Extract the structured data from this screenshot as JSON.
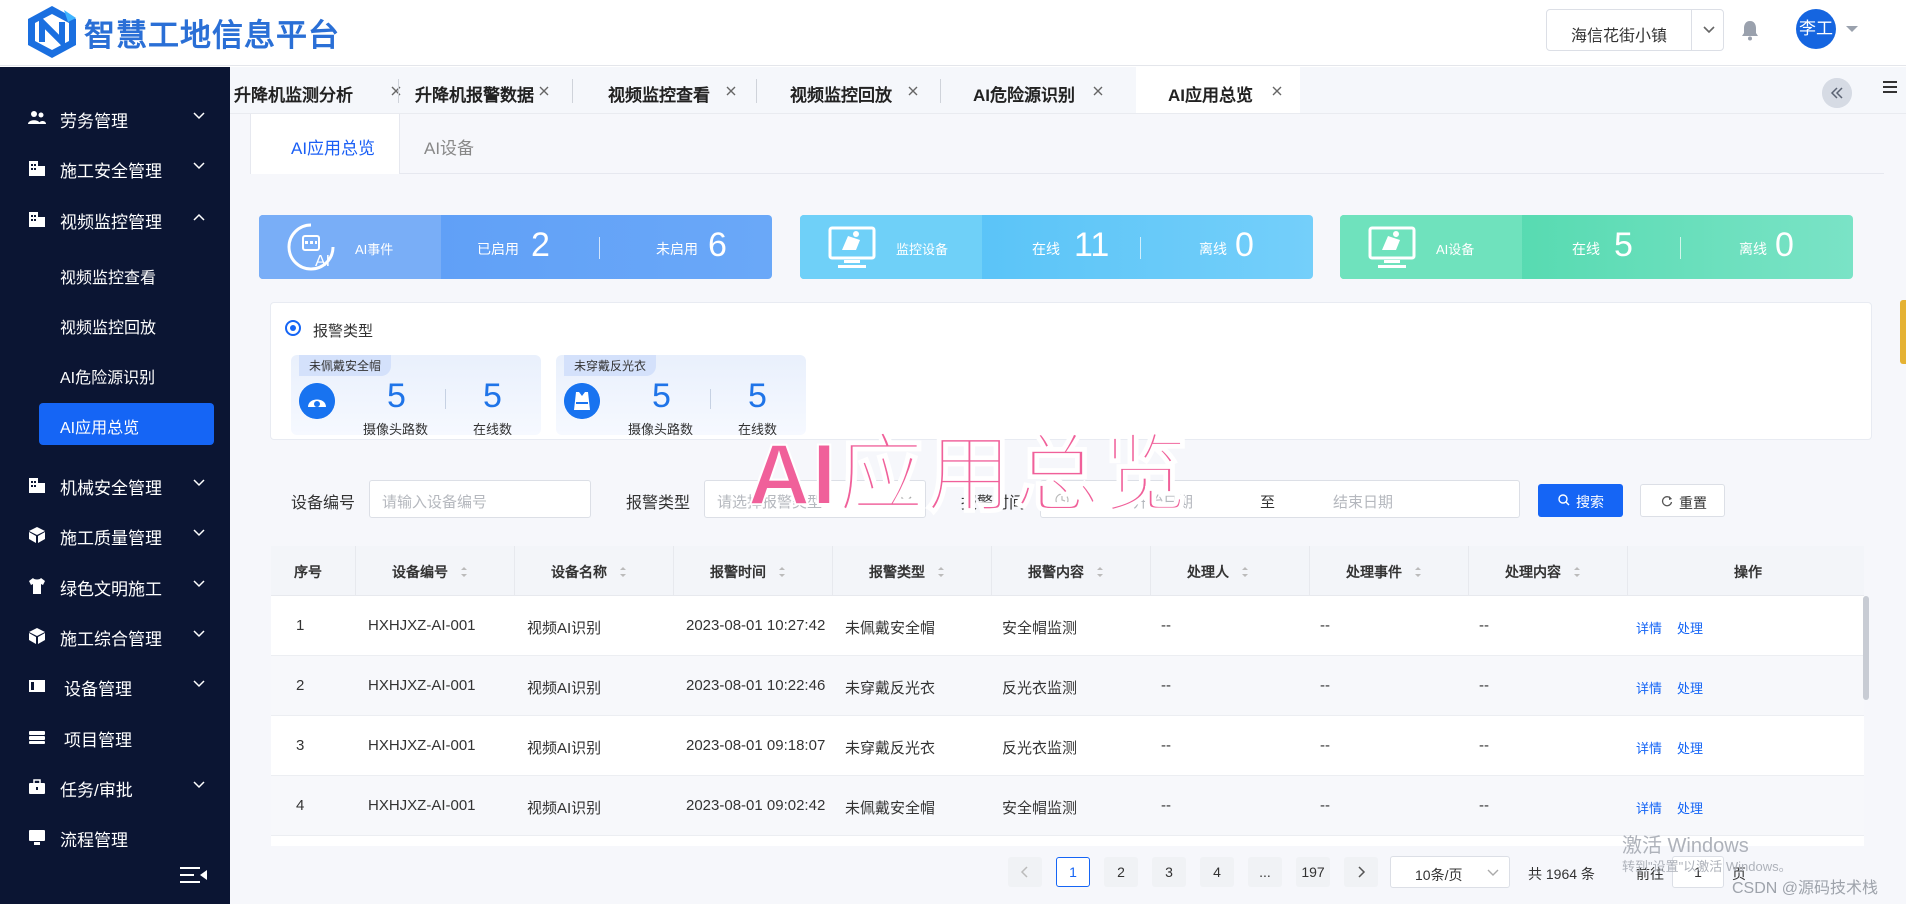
{
  "app": {
    "title": "智慧工地信息平台",
    "site": "海信花街小镇",
    "user": "李工"
  },
  "sidebar": {
    "items": [
      {
        "label": "劳务管理",
        "icon": "people-icon"
      },
      {
        "label": "施工安全管理",
        "icon": "building-icon"
      },
      {
        "label": "视频监控管理",
        "icon": "building-icon",
        "expanded": true
      },
      {
        "label": "机械安全管理",
        "icon": "building-icon"
      },
      {
        "label": "施工质量管理",
        "icon": "cube-icon"
      },
      {
        "label": "绿色文明施工",
        "icon": "shirt-icon"
      },
      {
        "label": "施工综合管理",
        "icon": "cube-icon"
      },
      {
        "label": "设备管理",
        "icon": "device-icon"
      },
      {
        "label": "项目管理",
        "icon": "folder-icon"
      },
      {
        "label": "任务/审批",
        "icon": "briefcase-icon"
      },
      {
        "label": "流程管理",
        "icon": "monitor-icon"
      }
    ],
    "subitems": [
      "视频监控查看",
      "视频监控回放",
      "AI危险源识别",
      "AI应用总览"
    ],
    "active_sub": "AI应用总览"
  },
  "tabs": [
    {
      "label": "升降机监测分析",
      "active": false
    },
    {
      "label": "升降机报警数据",
      "active": false
    },
    {
      "label": "视频监控查看",
      "active": false
    },
    {
      "label": "视频监控回放",
      "active": false
    },
    {
      "label": "AI危险源识别",
      "active": false
    },
    {
      "label": "AI应用总览",
      "active": true
    }
  ],
  "subtabs": [
    {
      "label": "AI应用总览",
      "active": true
    },
    {
      "label": "AI设备",
      "active": false
    }
  ],
  "cards": [
    {
      "title": "AI事件",
      "seg1_label": "已启用",
      "seg1_value": "2",
      "seg2_label": "未启用",
      "seg2_value": "6",
      "color": "#5b9cf6"
    },
    {
      "title": "监控设备",
      "seg1_label": "在线",
      "seg1_value": "11",
      "seg2_label": "离线",
      "seg2_value": "0",
      "color": "#5ec6f7"
    },
    {
      "title": "AI设备",
      "seg1_label": "在线",
      "seg1_value": "5",
      "seg2_label": "离线",
      "seg2_value": "0",
      "color": "#5adcb1"
    }
  ],
  "alarm": {
    "heading": "报警类型",
    "cards": [
      {
        "tag": "未佩戴安全帽",
        "cameras": "5",
        "cameras_label": "摄像头路数",
        "online": "5",
        "online_label": "在线数"
      },
      {
        "tag": "未穿戴反光衣",
        "cameras": "5",
        "cameras_label": "摄像头路数",
        "online": "5",
        "online_label": "在线数"
      }
    ]
  },
  "overlay_title": "AI应用总览",
  "filter": {
    "device_no_label": "设备编号",
    "device_no_placeholder": "请输入设备编号",
    "alarm_type_label": "报警类型",
    "alarm_type_placeholder": "请选择报警类型",
    "alarm_time_label": "报警时间",
    "start_placeholder": "开始日期",
    "range_sep": "至",
    "end_placeholder": "结束日期",
    "search_label": "搜索",
    "reset_label": "重置"
  },
  "table": {
    "headers": [
      "序号",
      "设备编号",
      "设备名称",
      "报警时间",
      "报警类型",
      "报警内容",
      "处理人",
      "处理事件",
      "处理内容",
      "操作"
    ],
    "rows": [
      {
        "no": "1",
        "device_no": "HXHJXZ-AI-001",
        "device_name": "视频AI识别",
        "time": "2023-08-01 10:27:42",
        "type": "未佩戴安全帽",
        "content": "安全帽监测",
        "handler": "--",
        "event": "--",
        "detail": "--"
      },
      {
        "no": "2",
        "device_no": "HXHJXZ-AI-001",
        "device_name": "视频AI识别",
        "time": "2023-08-01 10:22:46",
        "type": "未穿戴反光衣",
        "content": "反光衣监测",
        "handler": "--",
        "event": "--",
        "detail": "--"
      },
      {
        "no": "3",
        "device_no": "HXHJXZ-AI-001",
        "device_name": "视频AI识别",
        "time": "2023-08-01 09:18:07",
        "type": "未穿戴反光衣",
        "content": "反光衣监测",
        "handler": "--",
        "event": "--",
        "detail": "--"
      },
      {
        "no": "4",
        "device_no": "HXHJXZ-AI-001",
        "device_name": "视频AI识别",
        "time": "2023-08-01 09:02:42",
        "type": "未佩戴安全帽",
        "content": "安全帽监测",
        "handler": "--",
        "event": "--",
        "detail": "--"
      }
    ],
    "action_detail": "详情",
    "action_handle": "处理"
  },
  "pagination": {
    "pages": [
      "1",
      "2",
      "3",
      "4",
      "...",
      "197"
    ],
    "current": "1",
    "page_size": "10条/页",
    "total": "共 1964 条",
    "goto_label": "前往",
    "goto_value": "1",
    "page_suffix": "页"
  },
  "watermarks": {
    "win_line1": "激活 Windows",
    "win_line2": "转到\"设置\"以激活 Windows。",
    "csdn": "CSDN @源码技术栈"
  }
}
